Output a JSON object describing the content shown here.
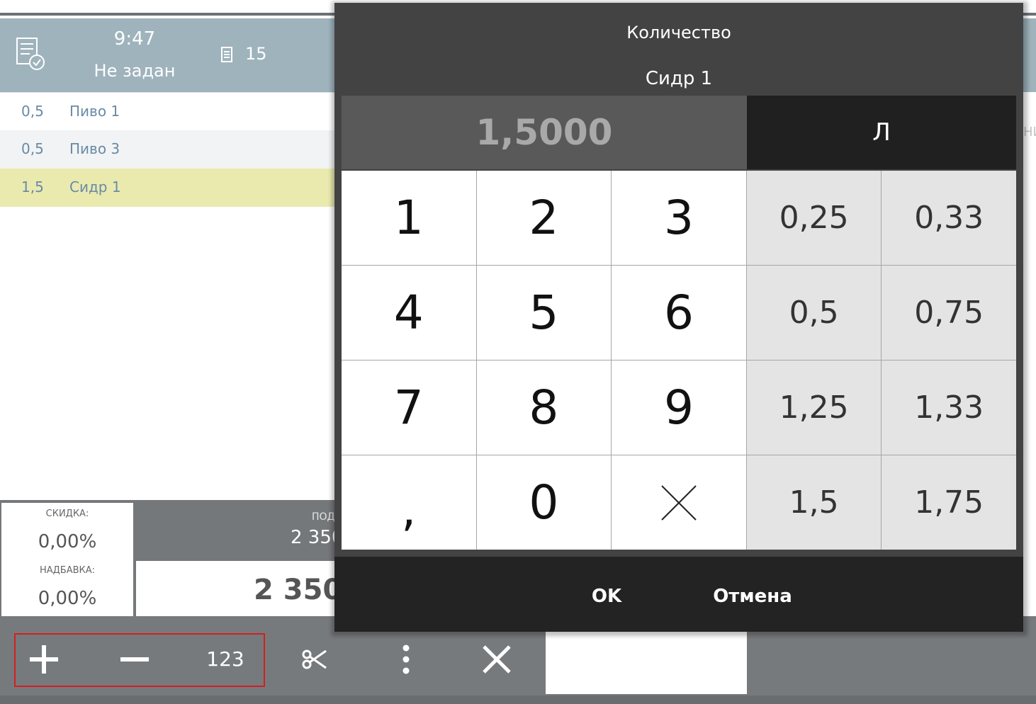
{
  "header": {
    "time": "9:47",
    "status": "Не задан",
    "guests": "15",
    "right_fragment": "НИ"
  },
  "order_lines": [
    {
      "qty": "0,5",
      "name": "Пиво 1"
    },
    {
      "qty": "0,5",
      "name": "Пиво 3"
    },
    {
      "qty": "1,5",
      "name": "Сидр 1"
    }
  ],
  "totals": {
    "discount_label": "СКИДКА:",
    "discount_value": "0,00%",
    "markup_label": "НАДБАВКА:",
    "markup_value": "0,00%",
    "subtotal_label": "ПОД",
    "subtotal_value": "2 350",
    "total_value": "2 350"
  },
  "toolbar": {
    "qty_label": "123"
  },
  "dialog": {
    "title": "Количество",
    "item_name": "Сидр 1",
    "value": "1,5000",
    "unit": "Л",
    "keys": [
      {
        "label": "1",
        "type": "digit"
      },
      {
        "label": "2",
        "type": "digit"
      },
      {
        "label": "3",
        "type": "digit"
      },
      {
        "label": "0,25",
        "type": "preset"
      },
      {
        "label": "0,33",
        "type": "preset"
      },
      {
        "label": "4",
        "type": "digit"
      },
      {
        "label": "5",
        "type": "digit"
      },
      {
        "label": "6",
        "type": "digit"
      },
      {
        "label": "0,5",
        "type": "preset"
      },
      {
        "label": "0,75",
        "type": "preset"
      },
      {
        "label": "7",
        "type": "digit"
      },
      {
        "label": "8",
        "type": "digit"
      },
      {
        "label": "9",
        "type": "digit"
      },
      {
        "label": "1,25",
        "type": "preset"
      },
      {
        "label": "1,33",
        "type": "preset"
      },
      {
        "label": ",",
        "type": "comma"
      },
      {
        "label": "0",
        "type": "digit"
      },
      {
        "label": "",
        "type": "clear",
        "icon": "close-icon"
      },
      {
        "label": "1,5",
        "type": "preset"
      },
      {
        "label": "1,75",
        "type": "preset"
      }
    ],
    "ok_label": "OK",
    "cancel_label": "Отмена"
  },
  "colors": {
    "header_bg": "#9fb3bd",
    "selected_row": "#eaeaaf",
    "toolbar_bg": "#777a7d",
    "dialog_bg": "#434343",
    "highlight_border": "#d41f1f"
  }
}
